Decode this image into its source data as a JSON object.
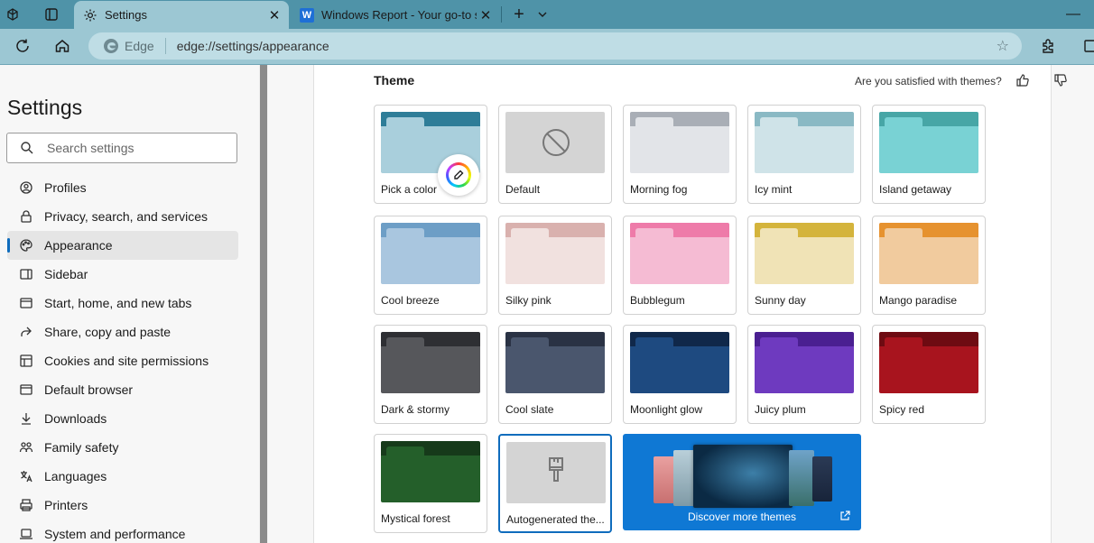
{
  "browser": {
    "tabs": [
      {
        "title": "Settings",
        "icon": "gear-icon",
        "active": true
      },
      {
        "title": "Windows Report - Your go-to so",
        "icon": "windows-report-favicon",
        "favicon_text": "W",
        "active": false
      }
    ],
    "address": {
      "edge_label": "Edge",
      "url": "edge://settings/appearance"
    }
  },
  "sidebar": {
    "title": "Settings",
    "search_placeholder": "Search settings",
    "items": [
      {
        "label": "Profiles",
        "icon": "profile-icon"
      },
      {
        "label": "Privacy, search, and services",
        "icon": "lock-icon"
      },
      {
        "label": "Appearance",
        "icon": "palette-icon",
        "selected": true
      },
      {
        "label": "Sidebar",
        "icon": "sidebar-icon"
      },
      {
        "label": "Start, home, and new tabs",
        "icon": "home-tabs-icon"
      },
      {
        "label": "Share, copy and paste",
        "icon": "share-icon"
      },
      {
        "label": "Cookies and site permissions",
        "icon": "cookies-icon"
      },
      {
        "label": "Default browser",
        "icon": "browser-icon"
      },
      {
        "label": "Downloads",
        "icon": "download-icon"
      },
      {
        "label": "Family safety",
        "icon": "family-icon"
      },
      {
        "label": "Languages",
        "icon": "languages-icon"
      },
      {
        "label": "Printers",
        "icon": "printer-icon"
      },
      {
        "label": "System and performance",
        "icon": "laptop-icon"
      }
    ]
  },
  "main": {
    "section_title": "Theme",
    "feedback_prompt": "Are you satisfied with themes?",
    "themes": [
      {
        "name": "Pick a color",
        "bar": "#2e7d98",
        "nub": "#a9cfdc",
        "body": "#a9cfdc"
      },
      {
        "name": "Default",
        "bar": "#d4d4d4",
        "nub": "#d4d4d4",
        "body": "#d4d4d4"
      },
      {
        "name": "Morning fog",
        "bar": "#a9aeb6",
        "nub": "#e2e4e8",
        "body": "#e2e4e8"
      },
      {
        "name": "Icy mint",
        "bar": "#8ab9c4",
        "nub": "#cfe3e8",
        "body": "#cfe3e8"
      },
      {
        "name": "Island getaway",
        "bar": "#47a6a6",
        "nub": "#79d2d4",
        "body": "#79d2d4"
      },
      {
        "name": "Cool breeze",
        "bar": "#6d9ec6",
        "nub": "#a9c6df",
        "body": "#a9c6df"
      },
      {
        "name": "Silky pink",
        "bar": "#d9b1ae",
        "nub": "#f1e1df",
        "body": "#f1e1df"
      },
      {
        "name": "Bubblegum",
        "bar": "#ee7ba9",
        "nub": "#f5bbd3",
        "body": "#f5bbd3"
      },
      {
        "name": "Sunny day",
        "bar": "#d4b43c",
        "nub": "#f0e3b6",
        "body": "#f0e3b6"
      },
      {
        "name": "Mango paradise",
        "bar": "#e6922f",
        "nub": "#f1cb9e",
        "body": "#f1cb9e"
      },
      {
        "name": "Dark & stormy",
        "bar": "#2e2f33",
        "nub": "#56575b",
        "body": "#56575b"
      },
      {
        "name": "Cool slate",
        "bar": "#2a3244",
        "nub": "#4a566d",
        "body": "#4a566d"
      },
      {
        "name": "Moonlight glow",
        "bar": "#10284a",
        "nub": "#1e4a80",
        "body": "#1e4a80"
      },
      {
        "name": "Juicy plum",
        "bar": "#4a1f91",
        "nub": "#6e3abf",
        "body": "#6e3abf"
      },
      {
        "name": "Spicy red",
        "bar": "#6e0b12",
        "nub": "#a8141e",
        "body": "#a8141e"
      },
      {
        "name": "Mystical forest",
        "bar": "#163a1a",
        "nub": "#245f2a",
        "body": "#245f2a"
      },
      {
        "name": "Autogenerated the...",
        "bar": "#d4d4d4",
        "nub": "#d4d4d4",
        "body": "#d4d4d4",
        "selected": true
      }
    ],
    "discover_label": "Discover more themes"
  }
}
